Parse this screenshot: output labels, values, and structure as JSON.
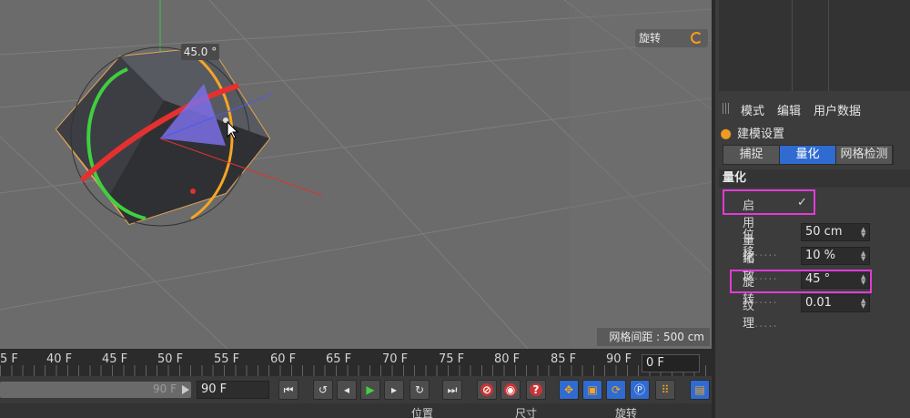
{
  "viewport": {
    "angle_label": "45.0 °",
    "rotate_chip": "旋转",
    "grid_spacing": "网格间距 : 500 cm"
  },
  "attributes": {
    "menu": [
      "模式",
      "编辑",
      "用户数据"
    ],
    "object_title": "建模设置",
    "tabs": [
      "捕捉",
      "量化",
      "网格检测"
    ],
    "active_tab": "量化",
    "section": "量化",
    "enable_label": "启用量化",
    "enable_check": "✓",
    "fields": [
      {
        "label": "位移",
        "dots": ".....",
        "value": "50 cm"
      },
      {
        "label": "缩放",
        "dots": ".....",
        "value": "10 %"
      },
      {
        "label": "旋转",
        "dots": ".....",
        "value": "45 °"
      },
      {
        "label": "纹理",
        "dots": ".....",
        "value": "0.01"
      }
    ]
  },
  "timeline": {
    "ruler": [
      "5 F",
      "40 F",
      "45 F",
      "50 F",
      "55 F",
      "60 F",
      "65 F",
      "70 F",
      "75 F",
      "80 F",
      "85 F",
      "90 F"
    ],
    "current_frame": "0 F",
    "slider_end": "90 F",
    "end_frame": "90 F"
  },
  "bottom": {
    "labels": [
      "位置",
      "尺寸",
      "旋转"
    ]
  },
  "colors": {
    "accent": "#2f6bd1",
    "highlight": "#e33ad6",
    "viewport_bg": "#6b6b6b"
  }
}
